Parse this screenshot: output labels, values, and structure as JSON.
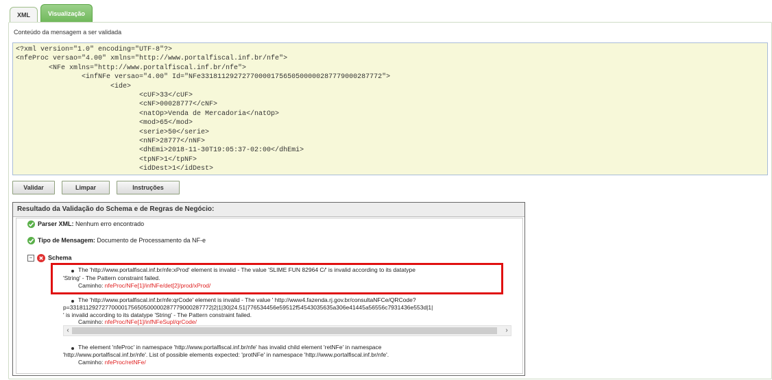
{
  "tabs": {
    "xml": "XML",
    "visualizacao": "Visualização"
  },
  "caption": "Conteúdo da mensagem a ser validada",
  "xml_lines": [
    "<?xml version=\"1.0\" encoding=\"UTF-8\"?>",
    "<nfeProc versao=\"4.00\" xmlns=\"http://www.portalfiscal.inf.br/nfe\">",
    "        <NFe xmlns=\"http://www.portalfiscal.inf.br/nfe\">",
    "                <infNFe versao=\"4.00\" Id=\"NFe33181129272770000175650500000287779000287772\">",
    "                       <ide>",
    "                              <cUF>33</cUF>",
    "                              <cNF>00028777</cNF>",
    "                              <natOp>Venda de Mercadoria</natOp>",
    "                              <mod>65</mod>",
    "                              <serie>50</serie>",
    "                              <nNF>28777</nNF>",
    "                              <dhEmi>2018-11-30T19:05:37-02:00</dhEmi>",
    "                              <tpNF>1</tpNF>",
    "                              <idDest>1</idDest>"
  ],
  "buttons": {
    "validar": "Validar",
    "limpar": "Limpar",
    "instrucoes": "Instruções"
  },
  "result": {
    "title": "Resultado da Validação do Schema e de Regras de Negócio:",
    "parser_label": "Parser XML:",
    "parser_value": "Nenhum erro encontrado",
    "tipo_label": "Tipo de Mensagem:",
    "tipo_value": "Documento de Processamento da NF-e",
    "schema_label": "Schema",
    "toggle": "−",
    "caminho_label": "Caminho:",
    "errors": [
      {
        "line1": "The 'http://www.portalfiscal.inf.br/nfe:xProd' element is invalid - The value 'SLIME FUN 82964 C/' is invalid according to its datatype",
        "line2": "'String' - The Pattern constraint failed.",
        "path": "nfeProc/NFe[1]/infNFe/det[2]/prod/xProd/"
      },
      {
        "line1": "The 'http://www.portalfiscal.inf.br/nfe:qrCode' element is invalid - The value ' http://www4.fazenda.rj.gov.br/consultaNFCe/QRCode?",
        "line2": "p=33181129272770000175650500000287779000287772|2|1|30|24.51|776534456e59512f54543035635a306e41445a56556c7931436e553d|1|",
        "line3": "' is invalid according to its datatype 'String' - The Pattern constraint failed.",
        "path": "nfeProc/NFe[1]/infNFeSupl/qrCode/"
      },
      {
        "line1": "The element 'nfeProc' in namespace 'http://www.portalfiscal.inf.br/nfe' has invalid child element 'retNFe' in namespace",
        "line2": "'http://www.portalfiscal.inf.br/nfe'. List of possible elements expected: 'protNFe' in namespace 'http://www.portalfiscal.inf.br/nfe'.",
        "path": "nfeProc/retNFe/"
      }
    ]
  },
  "colors": {
    "tab_active": "#6fb85a",
    "xml_bg": "#f7f8d9",
    "error_red": "#e01010",
    "ok_green": "#5ab04a"
  },
  "icons": [
    "check-circle-icon",
    "error-circle-icon",
    "collapse-toggle-icon",
    "scroll-left-arrow-icon",
    "scroll-right-arrow-icon"
  ]
}
